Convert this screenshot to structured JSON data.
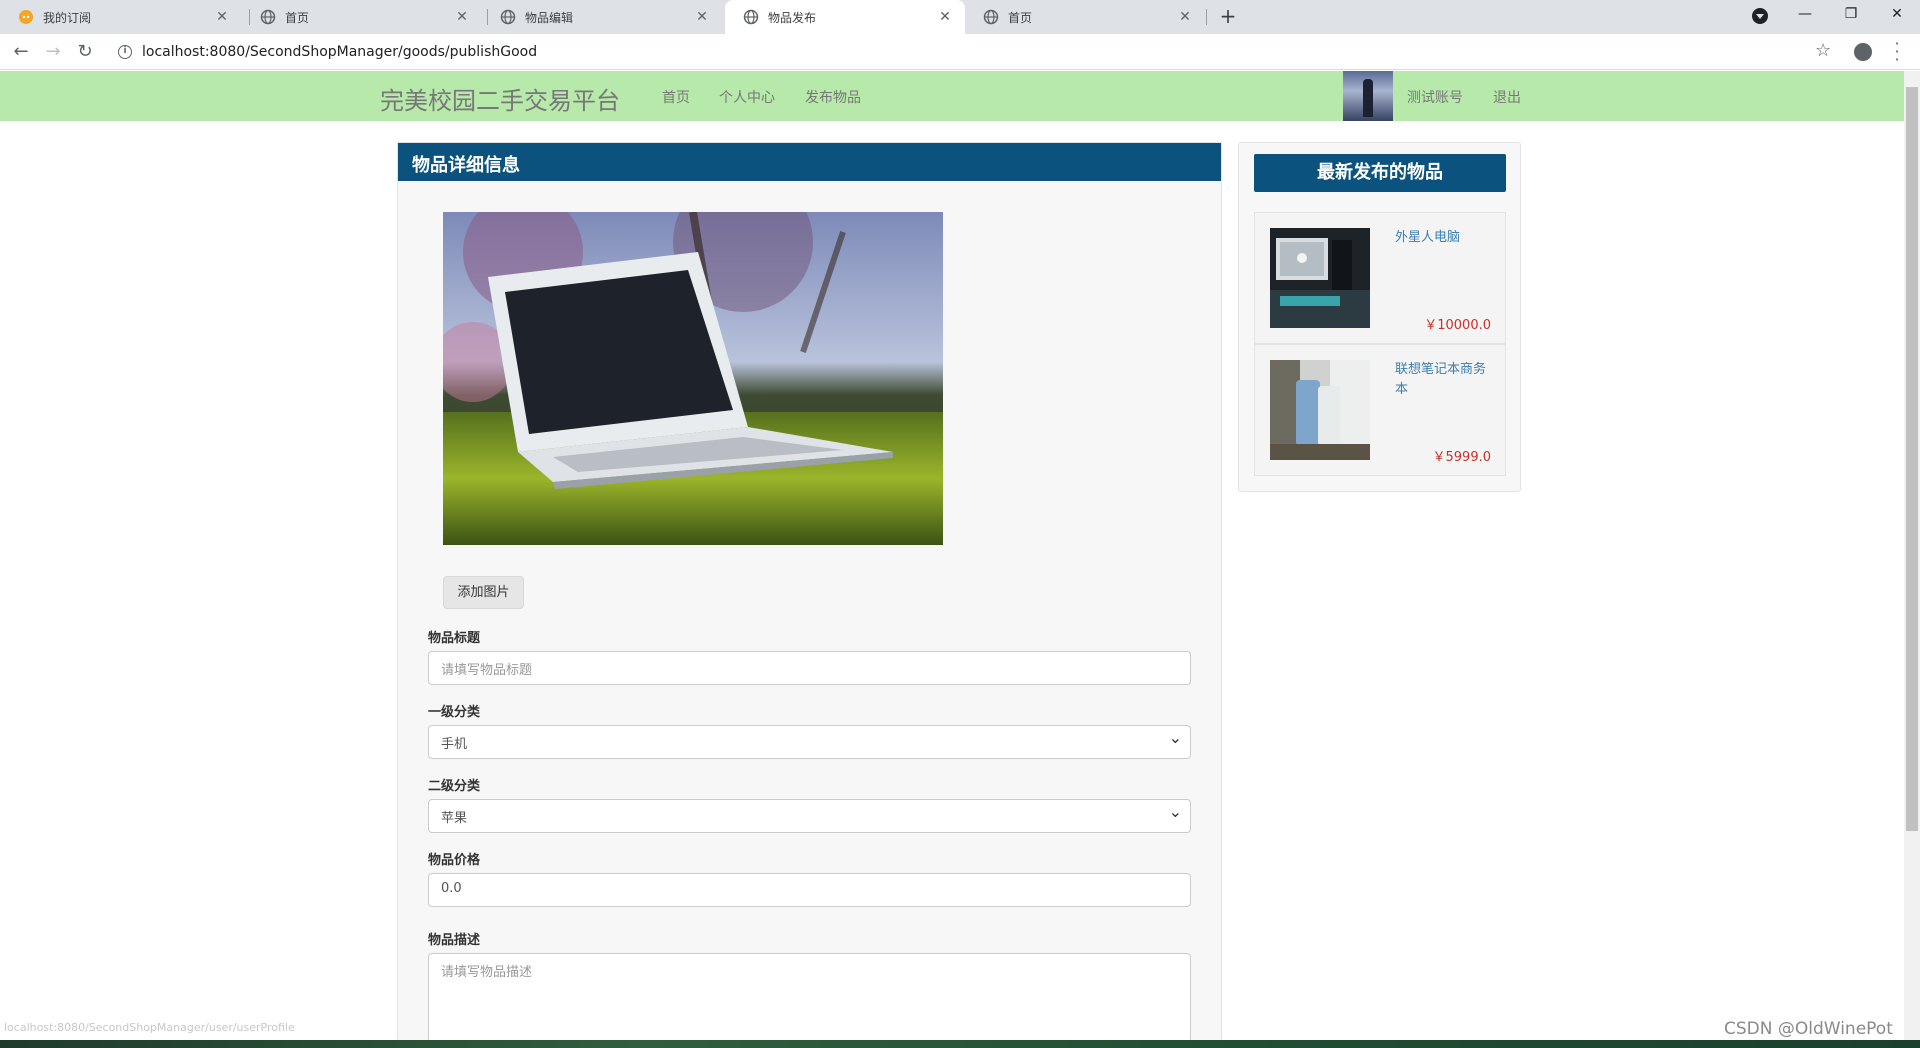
{
  "browser": {
    "tabs": [
      {
        "title": "我的订阅",
        "active": false
      },
      {
        "title": "首页",
        "active": false
      },
      {
        "title": "物品编辑",
        "active": false
      },
      {
        "title": "物品发布",
        "active": true
      },
      {
        "title": "首页",
        "active": false
      }
    ],
    "url": "localhost:8080/SecondShopManager/goods/publishGood",
    "status_url": "localhost:8080/SecondShopManager/user/userProfile"
  },
  "header": {
    "brand": "完美校园二手交易平台",
    "nav": [
      "首页",
      "个人中心",
      "发布物品"
    ],
    "account": "测试账号",
    "logout": "退出"
  },
  "main": {
    "panel_title": "物品详细信息",
    "add_image_label": "添加图片",
    "fields": {
      "title_label": "物品标题",
      "title_placeholder": "请填写物品标题",
      "category1_label": "一级分类",
      "category1_value": "手机",
      "category2_label": "二级分类",
      "category2_value": "苹果",
      "price_label": "物品价格",
      "price_value": "0.0",
      "desc_label": "物品描述",
      "desc_placeholder": "请填写物品描述"
    }
  },
  "sidebar": {
    "title": "最新发布的物品",
    "items": [
      {
        "title": "外星人电脑",
        "price": "￥10000.0"
      },
      {
        "title": "联想笔记本商务本",
        "price": "￥5999.0"
      }
    ]
  },
  "watermark": "CSDN @OldWinePot",
  "colors": {
    "header_bg": "#b7eaaa",
    "panel_head": "#0b527f",
    "price": "#c9302c",
    "link": "#3b7fb3"
  }
}
